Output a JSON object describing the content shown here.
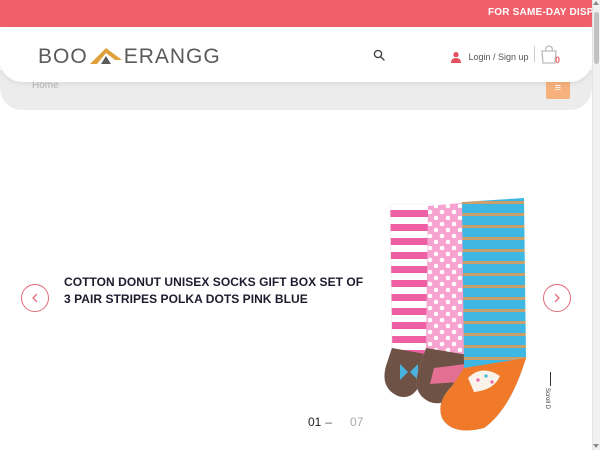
{
  "announcement": {
    "text": "FOR SAME-DAY DISP"
  },
  "brand": {
    "logo_left": "BOO",
    "logo_right": "ERANGG"
  },
  "header": {
    "login_label": "Login / Sign up",
    "cart_count": "0"
  },
  "breadcrumb": {
    "home_label": "Home"
  },
  "slider": {
    "product_title": "COTTON DONUT UNISEX SOCKS GIFT BOX SET OF 3 PAIR STRIPES POLKA DOTS PINK BLUE",
    "current": "01",
    "dash": "–",
    "total": "07",
    "scroll_label": "Scroll D"
  },
  "icons": {
    "search": "search-icon",
    "user": "user-icon",
    "cart": "shopping-bag-icon",
    "menu": "hamburger-icon",
    "prev": "chevron-left-icon",
    "next": "chevron-right-icon"
  },
  "colors": {
    "accent": "#f0606a",
    "menu_button": "#f6b17d",
    "arrow_border": "#e26c7a"
  }
}
